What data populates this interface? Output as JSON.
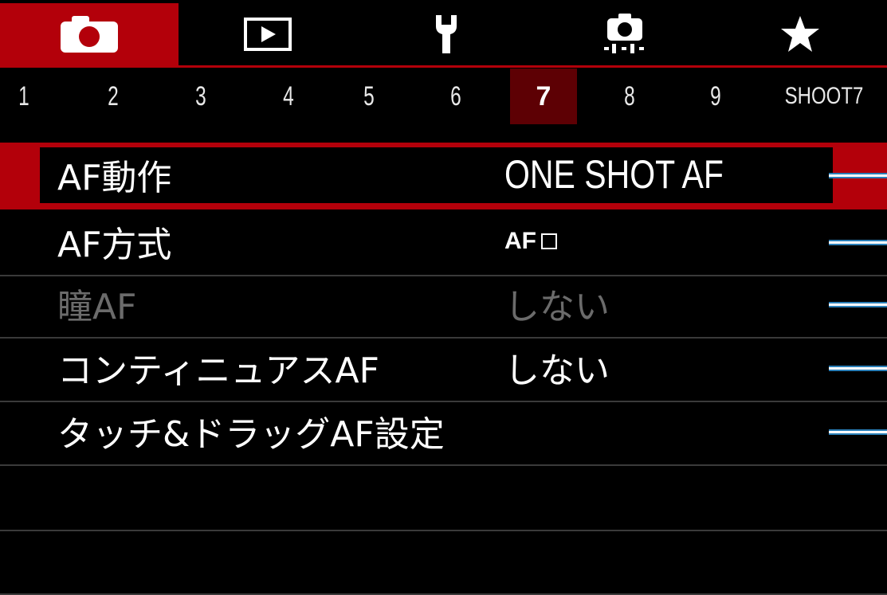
{
  "tabs": [
    {
      "icon": "camera-icon",
      "active": true
    },
    {
      "icon": "playback-icon",
      "active": false
    },
    {
      "icon": "wrench-icon",
      "active": false
    },
    {
      "icon": "custom-function-icon",
      "active": false
    },
    {
      "icon": "star-icon",
      "active": false
    }
  ],
  "pages": {
    "numbers": [
      "1",
      "2",
      "3",
      "4",
      "5",
      "6",
      "7",
      "8",
      "9"
    ],
    "active": "7",
    "tag": "SHOOT7"
  },
  "menu": {
    "items": [
      {
        "label": "AF動作",
        "value": "ONE SHOT AF",
        "state": "selected"
      },
      {
        "label": "AF方式",
        "value": "AF",
        "state": "normal"
      },
      {
        "label": "瞳AF",
        "value": "しない",
        "state": "disabled"
      },
      {
        "label": "コンティニュアスAF",
        "value": "しない",
        "state": "normal"
      },
      {
        "label": "タッチ&ドラッグAF設定",
        "value": "",
        "state": "normal"
      }
    ]
  },
  "colors": {
    "accent_red": "#b3000a",
    "active_page_bg": "#5d0004",
    "marker_blue": "#2a7fb8",
    "disabled_text": "#6b6b6b"
  }
}
